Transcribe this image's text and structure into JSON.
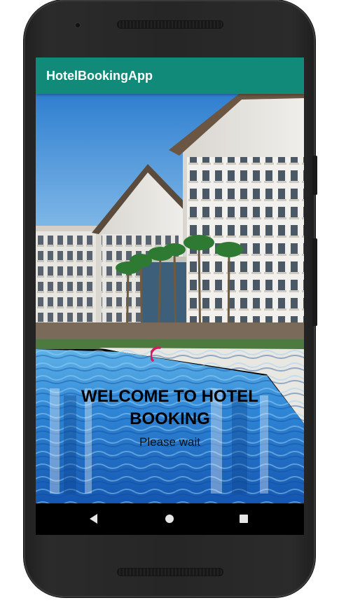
{
  "app": {
    "title": "HotelBookingApp"
  },
  "splash": {
    "welcome_text": "WELCOME TO HOTEL BOOKING",
    "wait_text": "Please wait",
    "spinner_color": "#d81b60"
  },
  "theme": {
    "app_bar_color": "#128a7a",
    "navbar_color": "#000000"
  },
  "navbar": {
    "back_icon": "back-triangle-icon",
    "home_icon": "home-circle-icon",
    "recents_icon": "recents-square-icon"
  }
}
